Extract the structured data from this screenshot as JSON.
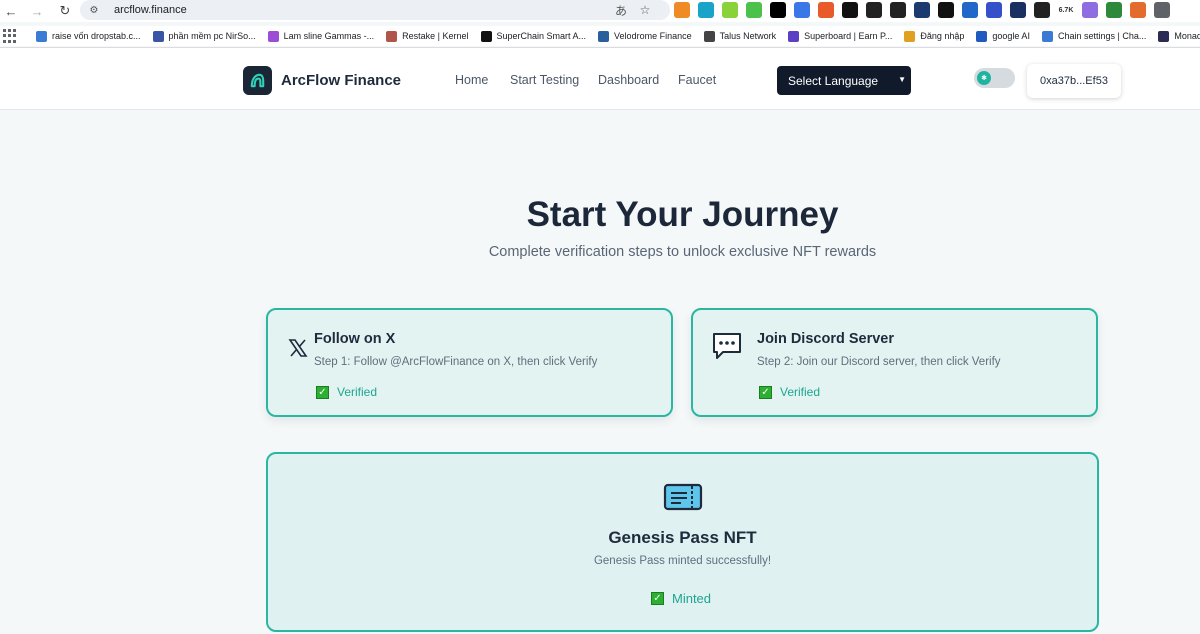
{
  "browser": {
    "url": "arcflow.finance",
    "bookmarks": [
      {
        "label": "raise vốn dropstab.c...",
        "color": "#3a7bd5"
      },
      {
        "label": "phần mềm pc NirSo...",
        "color": "#3955a5"
      },
      {
        "label": "Lam sline Gammas -...",
        "color": "#9b4dd6"
      },
      {
        "label": "Restake | Kernel",
        "color": "#b0554a"
      },
      {
        "label": "SuperChain Smart A...",
        "color": "#111111"
      },
      {
        "label": "Velodrome Finance",
        "color": "#2a5f9e"
      },
      {
        "label": "Talus Network",
        "color": "#444444"
      },
      {
        "label": "Superboard | Earn P...",
        "color": "#5b3fc4"
      },
      {
        "label": "Đăng nhập",
        "color": "#e0a020"
      },
      {
        "label": "google AI",
        "color": "#1f5bbf"
      },
      {
        "label": "Chain settings | Cha...",
        "color": "#3a7bd5"
      },
      {
        "label": "Monad Testnet: Test",
        "color": "#2b2b55"
      }
    ],
    "extensions": [
      {
        "name": "metamask-icon",
        "color": "#f08a24"
      },
      {
        "name": "extension-icon",
        "color": "#1aa3c8"
      },
      {
        "name": "extension-icon",
        "color": "#8ad23a"
      },
      {
        "name": "extension-icon",
        "color": "#4cc24c"
      },
      {
        "name": "extension-icon",
        "color": "#000000"
      },
      {
        "name": "translate-icon",
        "color": "#3b78e7"
      },
      {
        "name": "extension-icon",
        "color": "#e85a2a"
      },
      {
        "name": "extension-icon",
        "color": "#111111"
      },
      {
        "name": "extension-icon",
        "color": "#222222"
      },
      {
        "name": "extension-icon",
        "color": "#222222"
      },
      {
        "name": "extension-icon",
        "color": "#1b3b6f"
      },
      {
        "name": "extension-icon",
        "color": "#111111"
      },
      {
        "name": "extension-icon",
        "color": "#2067c9"
      },
      {
        "name": "extension-icon",
        "color": "#3550c9"
      },
      {
        "name": "extension-icon",
        "color": "#1a3060"
      },
      {
        "name": "extension-icon",
        "color": "#222222"
      },
      {
        "name": "extension-icon",
        "color": "#cccccc"
      },
      {
        "name": "extension-icon",
        "color": "#8e6de0"
      },
      {
        "name": "extension-icon",
        "color": "#2c8a3a"
      },
      {
        "name": "extension-icon",
        "color": "#e36b2e"
      },
      {
        "name": "puzzle-icon",
        "color": "#5f6368"
      }
    ],
    "ext_badge": "6.7K"
  },
  "header": {
    "brand": "ArcFlow Finance",
    "nav": [
      "Home",
      "Start Testing",
      "Dashboard",
      "Faucet"
    ],
    "language_select": "Select Language",
    "wallet": "0xa37b...Ef53",
    "accent": "#1fb49f"
  },
  "hero": {
    "title": "Start Your Journey",
    "subtitle": "Complete verification steps to unlock exclusive NFT rewards"
  },
  "cards": [
    {
      "icon": "x-logo-icon",
      "title": "Follow on X",
      "step": "Step 1: Follow @ArcFlowFinance on X, then click Verify",
      "status": "Verified"
    },
    {
      "icon": "chat-bubble-icon",
      "title": "Join Discord Server",
      "step": "Step 2: Join our Discord server, then click Verify",
      "status": "Verified"
    }
  ],
  "nft": {
    "icon": "ticket-icon",
    "title": "Genesis Pass NFT",
    "subtitle": "Genesis Pass minted successfully!",
    "status": "Minted"
  },
  "colors": {
    "card_border": "#2bb6a1",
    "card_bg": "#e3f3f1",
    "status_text": "#1ea58f",
    "check_green": "#2cb031"
  }
}
